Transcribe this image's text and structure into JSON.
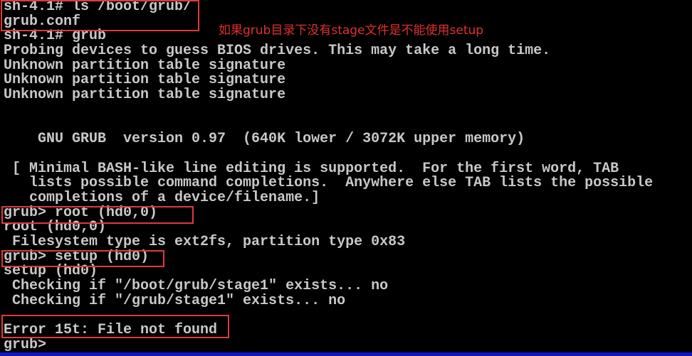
{
  "terminal": {
    "lines": [
      "sh-4.1# ls /boot/grub/",
      "grub.conf",
      "sh-4.1# grub",
      "Probing devices to guess BIOS drives. This may take a long time.",
      "Unknown partition table signature",
      "Unknown partition table signature",
      "Unknown partition table signature",
      "",
      "",
      "    GNU GRUB  version 0.97  (640K lower / 3072K upper memory)",
      "",
      " [ Minimal BASH-like line editing is supported.  For the first word, TAB",
      "   lists possible command completions.  Anywhere else TAB lists the possible",
      "   completions of a device/filename.]",
      "grub> root (hd0,0)",
      "root (hd0,0)",
      " Filesystem type is ext2fs, partition type 0x83",
      "grub> setup (hd0)",
      "setup (hd0)",
      " Checking if \"/boot/grub/stage1\" exists... no",
      " Checking if \"/grub/stage1\" exists... no",
      "",
      "Error 15t: File not found",
      "grub>"
    ]
  },
  "annotation": {
    "text": "如果grub目录下没有stage文件是不能使用setup",
    "color": "#e03030"
  },
  "colors": {
    "background": "#000000",
    "text": "#c8c8c8",
    "highlight_box": "#e03a3a",
    "bottom_bar": "#1414c8"
  }
}
